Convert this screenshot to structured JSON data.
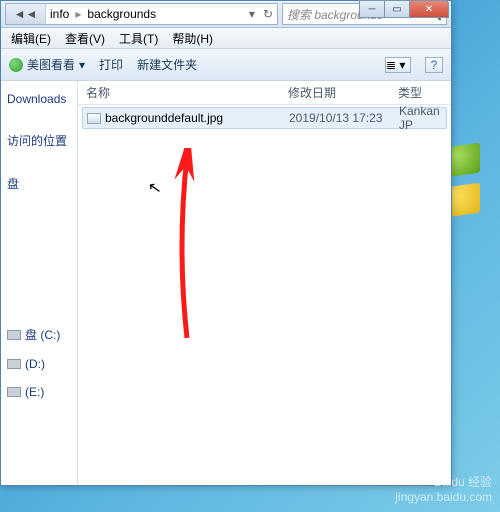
{
  "breadcrumb": {
    "seg1": "info",
    "seg2": "backgrounds"
  },
  "search": {
    "placeholder": "搜索 backgrounds"
  },
  "menu": {
    "edit": "编辑(E)",
    "view": "查看(V)",
    "tools": "工具(T)",
    "help": "帮助(H)"
  },
  "toolbar": {
    "meitu": "美图看看",
    "print": "打印",
    "newfolder": "新建文件夹"
  },
  "columns": {
    "name": "名称",
    "modified": "修改日期",
    "type": "类型"
  },
  "file": {
    "name": "backgrounddefault.jpg",
    "modified": "2019/10/13 17:23",
    "type": "Kankan JP"
  },
  "sidebar": {
    "downloads": "Downloads",
    "recent": "访问的位置",
    "disk": "盘",
    "sysdrive": "盘 (C:)",
    "d": "(D:)",
    "e": "(E:)"
  },
  "watermark": {
    "brand": "Baidu 经验",
    "url": "jingyan.baidu.com"
  }
}
